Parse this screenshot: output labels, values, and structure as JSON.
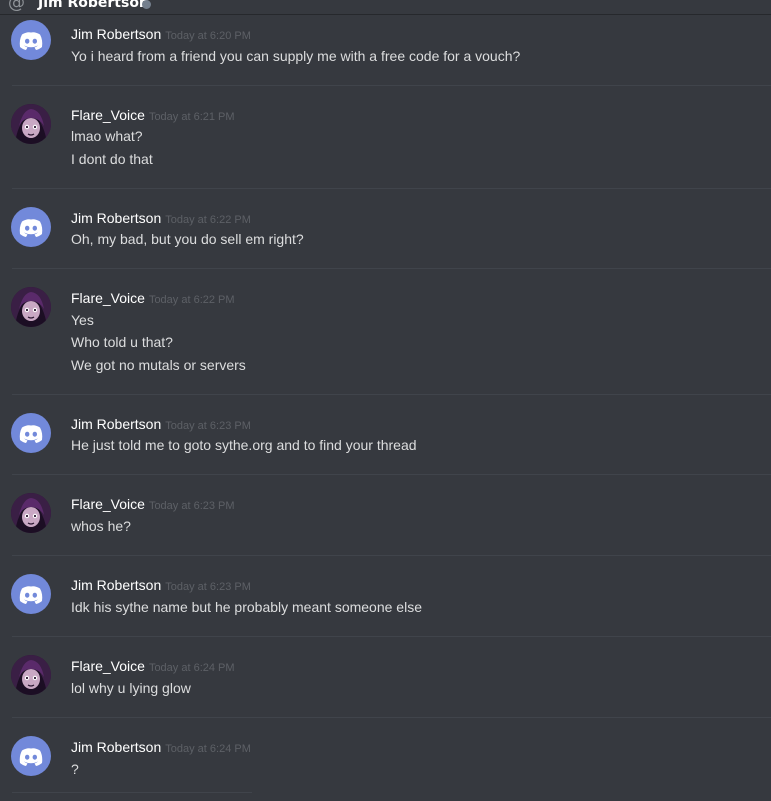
{
  "header": {
    "at_icon": "@",
    "name": "Jim Robertson",
    "status_color": "#747f8d"
  },
  "colors": {
    "background": "#36393f",
    "discord_avatar": "#7289da",
    "username": "#ffffff",
    "timestamp": "#5d6066",
    "message_text": "#dcddde"
  },
  "messages": [
    {
      "author": "Jim Robertson",
      "avatar": "discord-logo-icon",
      "time": "Today at 6:20 PM",
      "lines": [
        "Yo i heard from a friend you can supply me with a free code for a vouch?"
      ]
    },
    {
      "author": "Flare_Voice",
      "avatar": "anime-avatar",
      "time": "Today at 6:21 PM",
      "lines": [
        "lmao what?",
        "I dont do that"
      ]
    },
    {
      "author": "Jim Robertson",
      "avatar": "discord-logo-icon",
      "time": "Today at 6:22 PM",
      "lines": [
        "Oh, my bad, but you do sell em right?"
      ]
    },
    {
      "author": "Flare_Voice",
      "avatar": "anime-avatar",
      "time": "Today at 6:22 PM",
      "lines": [
        "Yes",
        "Who told u that?",
        "We got no mutals or servers"
      ]
    },
    {
      "author": "Jim Robertson",
      "avatar": "discord-logo-icon",
      "time": "Today at 6:23 PM",
      "lines": [
        "He just told me to goto sythe.org and to find your thread"
      ]
    },
    {
      "author": "Flare_Voice",
      "avatar": "anime-avatar",
      "time": "Today at 6:23 PM",
      "lines": [
        "whos he?"
      ]
    },
    {
      "author": "Jim Robertson",
      "avatar": "discord-logo-icon",
      "time": "Today at 6:23 PM",
      "lines": [
        "Idk his sythe name but he probably meant someone else"
      ]
    },
    {
      "author": "Flare_Voice",
      "avatar": "anime-avatar",
      "time": "Today at 6:24 PM",
      "lines": [
        "lol why u lying glow"
      ]
    },
    {
      "author": "Jim Robertson",
      "avatar": "discord-logo-icon",
      "time": "Today at 6:24 PM",
      "lines": [
        "?"
      ]
    }
  ]
}
